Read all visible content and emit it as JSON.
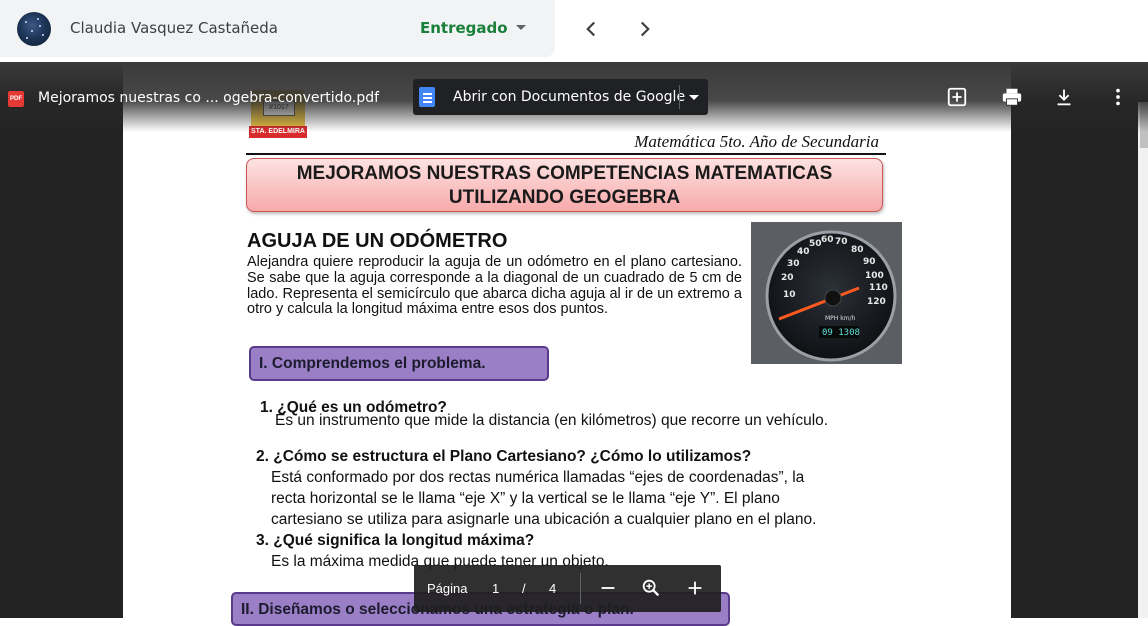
{
  "student": {
    "name": "Claudia Vasquez Castañeda",
    "status": "Entregado"
  },
  "viewer": {
    "file_icon_label": "PDF",
    "file_name": "Mejoramos nuestras co ... ogebra-convertido.pdf",
    "open_with_label": "Abrir con Documentos de Google"
  },
  "page": {
    "logo_badge": "#1017",
    "logo_name": "STA. EDELMIRA",
    "header_subtitle": "Matemática 5to. Año de Secundaria",
    "title_line1": "MEJORAMOS NUESTRAS COMPETENCIAS MATEMATICAS",
    "title_line2": "UTILIZANDO GEOGEBRA",
    "section_title": "AGUJA DE UN ODÓMETRO",
    "intro": "Alejandra quiere reproducir la aguja de un odómetro en el plano cartesiano. Se sabe que la aguja corresponde a la diagonal de un cuadrado de 5 cm de lado. Representa el semicírculo que abarca dicha aguja al ir de un extremo a otro y calcula la longitud máxima entre esos dos puntos.",
    "odometer_reading": "09 1308",
    "odometer_unit": "MPH km/h",
    "step1": "I. Comprendemos el problema.",
    "q1_title": "1. ¿Qué es un odómetro?",
    "q1_text": "Es un instrumento que mide la distancia (en kilómetros) que recorre un vehículo.",
    "q2_title": "2. ¿Cómo se estructura el Plano Cartesiano? ¿Cómo lo utilizamos?",
    "q2_lines": [
      "Está conformado por dos rectas numérica llamadas “ejes de coordenadas”, la",
      "recta horizontal se le llama “eje X” y la vertical se le llama “eje Y”. El plano",
      "cartesiano se utiliza para asignarle una ubicación a cualquier plano en el plano."
    ],
    "q3_title": "3. ¿Qué significa la longitud máxima?",
    "q3_text": "Es la máxima medida que puede tener un objeto.",
    "step2": "II. Diseñamos o seleccionamos una estrategia o plan."
  },
  "pagebar": {
    "label": "Página",
    "current": "1",
    "separator": "/",
    "total": "4"
  }
}
